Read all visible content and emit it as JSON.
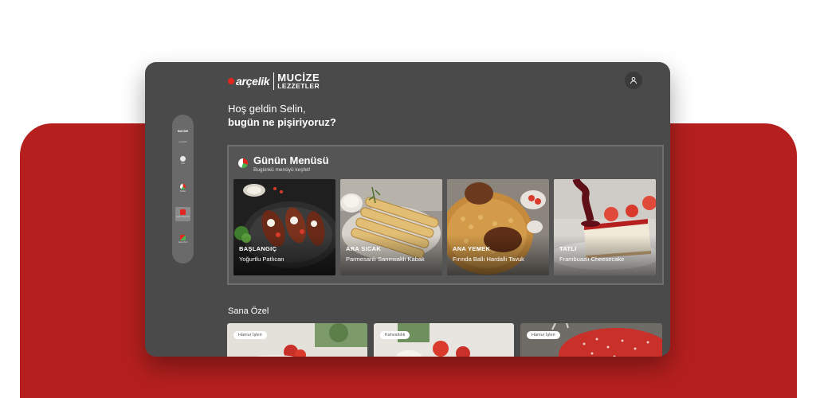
{
  "brand": {
    "name": "arçelik",
    "product_line1": "MUCİZE",
    "product_line2": "LEZZETLER"
  },
  "colors": {
    "accent": "#b5201e",
    "brand_red": "#e3261f",
    "device_bg": "#4a4a4a"
  },
  "profile": {
    "icon": "user-icon"
  },
  "greeting": {
    "line1": "Hoş geldin Selin,",
    "line2": "bugün ne pişiriyoruz?"
  },
  "sidebar": {
    "logo": "MUCİZE",
    "logo_sub": "Lezzetler",
    "items": [
      {
        "label": "Ana",
        "icon": "home-icon"
      },
      {
        "label": "Tarifler",
        "icon": "recipes-icon"
      },
      {
        "label": "Günün Menüsü",
        "icon": "menu-icon"
      },
      {
        "label": "Sana Özel",
        "icon": "bookmark-icon"
      }
    ]
  },
  "daily_menu": {
    "title": "Günün Menüsü",
    "subtitle": "Bugünkü menüyü keşfet!",
    "cards": [
      {
        "course": "BAŞLANGIÇ",
        "dish": "Yoğurtlu Patlıcan"
      },
      {
        "course": "ARA SICAK",
        "dish": "Parmesanlı Sarımsaklı Kabak"
      },
      {
        "course": "ANA YEMEK",
        "dish": "Fırında Ballı Hardallı Tavuk"
      },
      {
        "course": "TATLI",
        "dish": "Frambuazlı Cheesecake"
      }
    ]
  },
  "for_you": {
    "title": "Sana Özel",
    "cards": [
      {
        "tag": "Hamur İşleri"
      },
      {
        "tag": "Kahvaltılık"
      },
      {
        "tag": "Hamur İşleri"
      }
    ]
  }
}
